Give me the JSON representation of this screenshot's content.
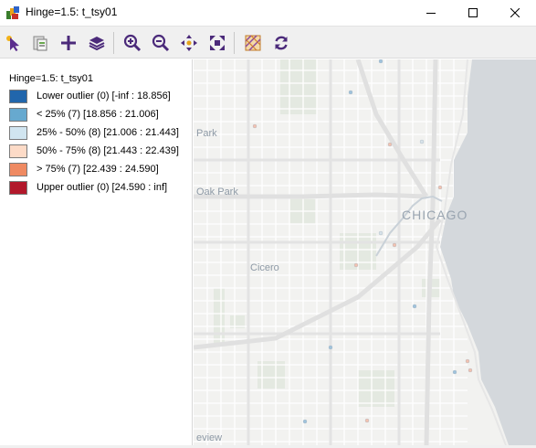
{
  "window": {
    "title": "Hinge=1.5: t_tsy01",
    "icon": "geoda-app-icon"
  },
  "toolbar": {
    "buttons": [
      {
        "name": "select-tool-button",
        "icon": "arrow-cursor-icon"
      },
      {
        "name": "copy-map-button",
        "icon": "clipboard-icon"
      },
      {
        "name": "add-layer-button",
        "icon": "plus-icon"
      },
      {
        "name": "layers-button",
        "icon": "layers-stack-icon"
      },
      {
        "name": "zoom-in-button",
        "icon": "zoom-in-icon"
      },
      {
        "name": "zoom-out-button",
        "icon": "zoom-out-icon"
      },
      {
        "name": "pan-button",
        "icon": "pan-arrows-icon"
      },
      {
        "name": "full-extent-button",
        "icon": "full-extent-icon"
      },
      {
        "name": "basemap-button",
        "icon": "basemap-icon"
      },
      {
        "name": "refresh-button",
        "icon": "refresh-icon"
      }
    ]
  },
  "legend": {
    "title": "Hinge=1.5: t_tsy01",
    "items": [
      {
        "label": "Lower outlier (0)  [-inf : 18.856]",
        "color": "#2166ac"
      },
      {
        "label": "< 25% (7)  [18.856 : 21.006]",
        "color": "#67a9cf"
      },
      {
        "label": "25% - 50% (8)  [21.006 : 21.443]",
        "color": "#d1e5f0"
      },
      {
        "label": "50% - 75% (8)  [21.443 : 22.439]",
        "color": "#fddbc7"
      },
      {
        "label": "> 75% (7)  [22.439 : 24.590]",
        "color": "#ef8a62"
      },
      {
        "label": "Upper outlier (0)  [24.590 : inf]",
        "color": "#b2182b"
      }
    ]
  },
  "map": {
    "labels": {
      "park": "Park",
      "oak_park": "Oak Park",
      "chicago": "CHICAGO",
      "cicero": "Cicero",
      "bottom_partial": "eview"
    },
    "lake_color": "#d4d8dc",
    "land_color": "#f2f2f0"
  }
}
